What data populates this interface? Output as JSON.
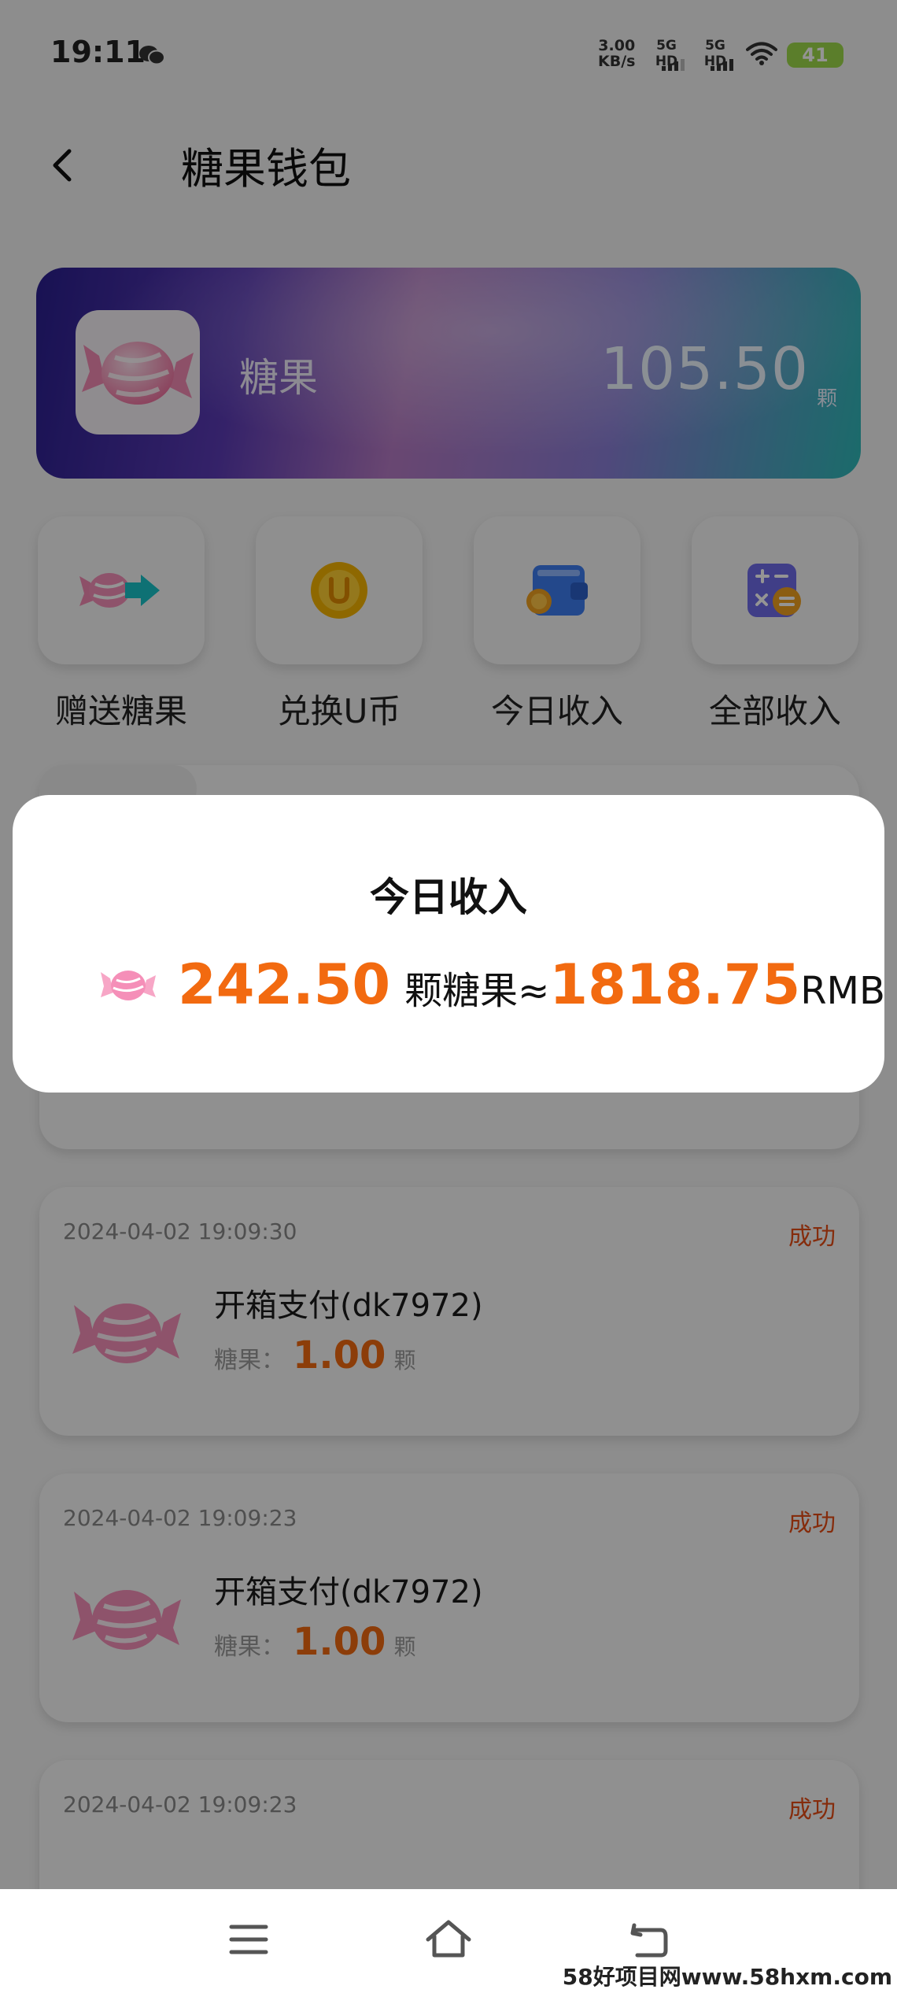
{
  "status_bar": {
    "time": "19:11",
    "net_speed_value": "3.00",
    "net_speed_unit": "KB/s",
    "sim1_label": "5G HD",
    "sim2_label": "5G HD",
    "battery": "41"
  },
  "header": {
    "title": "糖果钱包"
  },
  "wallet_card": {
    "label": "糖果",
    "amount": "105.50",
    "unit": "颗"
  },
  "actions": [
    {
      "label": "赠送糖果",
      "icon": "candy-send-icon"
    },
    {
      "label": "兑换U币",
      "icon": "u-coin-icon"
    },
    {
      "label": "今日收入",
      "icon": "wallet-icon"
    },
    {
      "label": "全部收入",
      "icon": "calculator-icon"
    }
  ],
  "modal": {
    "title": "今日收入",
    "candy_amount": "242.50",
    "candy_text": "颗糖果≈",
    "rmb_amount": "1818.75",
    "rmb_unit": "RMB"
  },
  "records": [
    {
      "time": "2024-04-02 19:09:30",
      "status": "成功",
      "title": "开箱支付(dk7972)",
      "key": "糖果：",
      "amount": "1.00",
      "unit": "颗"
    },
    {
      "time": "2024-04-02 19:09:23",
      "status": "成功",
      "title": "开箱支付(dk7972)",
      "key": "糖果：",
      "amount": "1.00",
      "unit": "颗"
    },
    {
      "time": "2024-04-02 19:09:23",
      "status": "成功"
    }
  ],
  "watermark": "58好项目网www.58hxm.com",
  "colors": {
    "accent": "#f26a10",
    "success_text": "#e54d15",
    "battery": "#9ed94a"
  }
}
